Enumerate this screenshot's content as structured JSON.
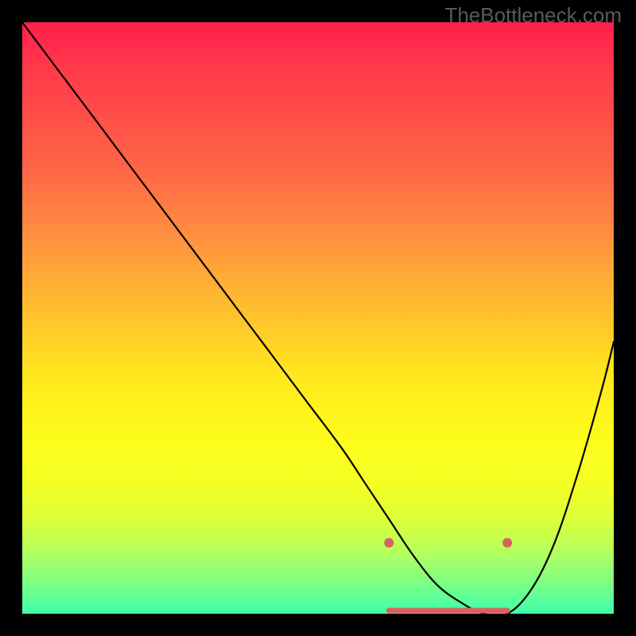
{
  "watermark": "TheBottleneck.com",
  "chart_data": {
    "type": "line",
    "title": "",
    "xlabel": "",
    "ylabel": "",
    "x_range": [
      0,
      100
    ],
    "y_range": [
      0,
      100
    ],
    "series": [
      {
        "name": "bottleneck-curve",
        "x": [
          0,
          6,
          12,
          18,
          24,
          30,
          36,
          42,
          48,
          54,
          58,
          62,
          66,
          70,
          74,
          78,
          82,
          86,
          90,
          94,
          98,
          100
        ],
        "y": [
          100,
          92,
          84,
          76,
          68,
          60,
          52,
          44,
          36,
          28,
          22,
          16,
          10,
          5,
          2,
          0,
          0,
          4,
          12,
          24,
          38,
          46
        ]
      }
    ],
    "optimal_band": {
      "x_start": 62,
      "x_end": 82,
      "y": 0
    },
    "markers": [
      {
        "x": 62,
        "y": 12
      },
      {
        "x": 82,
        "y": 12
      }
    ],
    "background_gradient": {
      "top": "#ff1f4d",
      "mid": "#ffe81f",
      "bottom": "#3fffac"
    }
  }
}
